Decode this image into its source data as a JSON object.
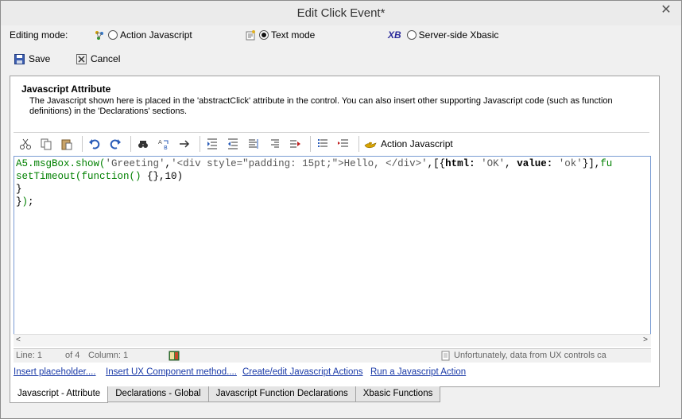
{
  "window": {
    "title": "Edit Click Event*",
    "close_glyph": "✕"
  },
  "mode": {
    "label": "Editing mode:",
    "options": [
      {
        "label": "Action Javascript",
        "selected": false,
        "icon": "action-javascript-icon"
      },
      {
        "label": "Text mode",
        "selected": true,
        "icon": "text-mode-icon"
      },
      {
        "label": "Server-side Xbasic",
        "selected": false,
        "icon": "xbasic-icon",
        "badge": "XB"
      }
    ]
  },
  "actions": {
    "save": "Save",
    "cancel": "Cancel"
  },
  "panel": {
    "title": "Javascript Attribute",
    "description": "The Javascript shown here is placed in the 'abstractClick' attribute in the control. You can also insert other supporting Javascript code (such as function definitions) in the 'Declarations' sections."
  },
  "toolbar": {
    "action_javascript_label": "Action Javascript"
  },
  "status": {
    "line": "Line: 1",
    "of": "of 4",
    "column": "Column: 1",
    "message": "Unfortunately, data from UX controls ca"
  },
  "links": [
    "Insert placeholder....",
    "Insert UX Component method....",
    "Create/edit Javascript Actions",
    "Run a Javascript Action"
  ],
  "tabs": [
    {
      "label": "Javascript - Attribute",
      "active": true
    },
    {
      "label": "Declarations - Global",
      "active": false
    },
    {
      "label": "Javascript Function Declarations",
      "active": false
    },
    {
      "label": "Xbasic Functions",
      "active": false
    }
  ],
  "colors": {
    "link": "#1a3aa8",
    "code_green": "#008000",
    "editor_border": "#7a9cd3"
  }
}
